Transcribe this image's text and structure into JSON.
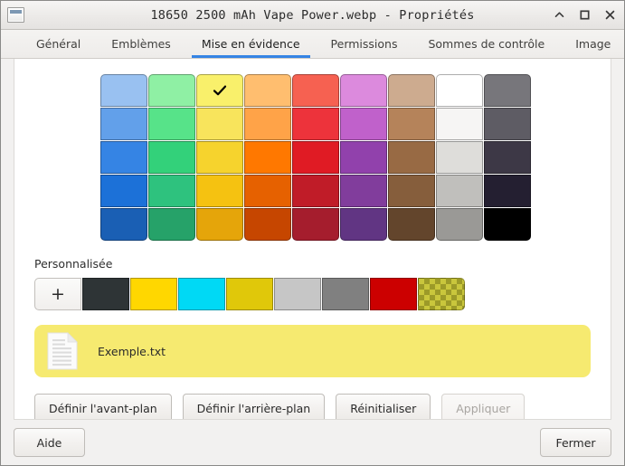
{
  "window": {
    "title": "18650 2500 mAh Vape Power.webp - Propriétés",
    "icon": "window-icon",
    "controls": [
      {
        "name": "shade-button",
        "glyph": "chevron-up-icon"
      },
      {
        "name": "maximize-button",
        "glyph": "square-icon"
      },
      {
        "name": "close-button",
        "glyph": "close-x-icon"
      }
    ]
  },
  "tabs": [
    {
      "label": "Général",
      "active": false
    },
    {
      "label": "Emblèmes",
      "active": false
    },
    {
      "label": "Mise en évidence",
      "active": true
    },
    {
      "label": "Permissions",
      "active": false
    },
    {
      "label": "Sommes de contrôle",
      "active": false
    },
    {
      "label": "Image",
      "active": false
    }
  ],
  "accent_color": "#3584e4",
  "palette": {
    "columns": 9,
    "rows": 5,
    "selected_index": 2,
    "selected_color": "#f9f06b",
    "checkmark_color": "#000000",
    "colors": [
      "#99c1f1",
      "#8ff0a4",
      "#f9f06b",
      "#ffbe6f",
      "#f66151",
      "#dc8add",
      "#cdab8f",
      "#ffffff",
      "#77767b",
      "#62a0ea",
      "#57e389",
      "#f8e45c",
      "#ffa348",
      "#ed333b",
      "#c061cb",
      "#b5835a",
      "#f6f5f4",
      "#5e5c64",
      "#3584e4",
      "#33d17a",
      "#f6d32d",
      "#ff7800",
      "#e01b24",
      "#9141ac",
      "#986a44",
      "#deddda",
      "#3d3846",
      "#1c71d8",
      "#2ec27e",
      "#f5c211",
      "#e66100",
      "#c01c28",
      "#813d9c",
      "#865e3c",
      "#c0bfbc",
      "#241f31",
      "#1a5fb4",
      "#26a269",
      "#e5a50a",
      "#c64600",
      "#a51d2d",
      "#613583",
      "#63452c",
      "#9a9996",
      "#000000"
    ]
  },
  "custom": {
    "label": "Personnalisée",
    "add_label": "+",
    "swatches": [
      "#2e3436",
      "#ffd700",
      "#00d9f5",
      "#e0c80a",
      "#c6c6c6",
      "#808080",
      "#cc0000",
      "checkerboard"
    ],
    "checker_colors": [
      "#c9c63c",
      "#9c9a28"
    ]
  },
  "preview": {
    "filename": "Exemple.txt",
    "background_color": "#f6ea70",
    "foreground_color": "#2a2a2a",
    "icon": "document-icon"
  },
  "actions": [
    {
      "label": "Définir l'avant-plan",
      "name": "set-foreground-button",
      "disabled": false
    },
    {
      "label": "Définir l'arrière-plan",
      "name": "set-background-button",
      "disabled": false
    },
    {
      "label": "Réinitialiser",
      "name": "reset-button",
      "disabled": false
    },
    {
      "label": "Appliquer",
      "name": "apply-button",
      "disabled": true
    }
  ],
  "bottom": {
    "help_label": "Aide",
    "close_label": "Fermer"
  }
}
